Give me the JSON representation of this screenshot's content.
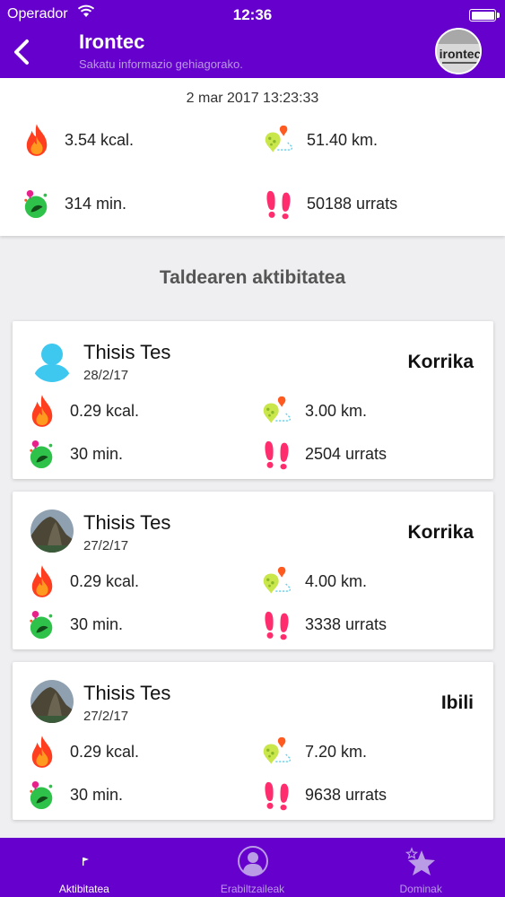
{
  "status": {
    "carrier": "Operador",
    "time": "12:36"
  },
  "header": {
    "title": "Irontec",
    "subtitle": "Sakatu informazio gehiagorako.",
    "logo_text": "irontec"
  },
  "summary": {
    "date": "2 mar 2017 13:23:33",
    "calories": "3.54 kcal.",
    "distance": "51.40 km.",
    "time": "314 min.",
    "steps": "50188 urrats"
  },
  "section_title": "Taldearen aktibitatea",
  "activities": [
    {
      "name": "Thisis Tes",
      "date": "28/2/17",
      "type": "Korrika",
      "calories": "0.29 kcal.",
      "distance": "3.00 km.",
      "time": "30 min.",
      "steps": "2504 urrats"
    },
    {
      "name": "Thisis Tes",
      "date": "27/2/17",
      "type": "Korrika",
      "calories": "0.29 kcal.",
      "distance": "4.00 km.",
      "time": "30 min.",
      "steps": "3338 urrats"
    },
    {
      "name": "Thisis Tes",
      "date": "27/2/17",
      "type": "Ibili",
      "calories": "0.29 kcal.",
      "distance": "7.20 km.",
      "time": "30 min.",
      "steps": "9638 urrats"
    }
  ],
  "tabs": [
    {
      "label": "Aktibitatea",
      "icon": "flag-icon",
      "active": true
    },
    {
      "label": "Erabiltzaileak",
      "icon": "user-icon",
      "active": false
    },
    {
      "label": "Dominak",
      "icon": "star-icon",
      "active": false
    }
  ],
  "colors": {
    "brand": "#6600cc",
    "flame": "#ff5a1f",
    "pin": "#b8e04a",
    "steps": "#ff2d6e",
    "clock": "#2fc24a"
  }
}
